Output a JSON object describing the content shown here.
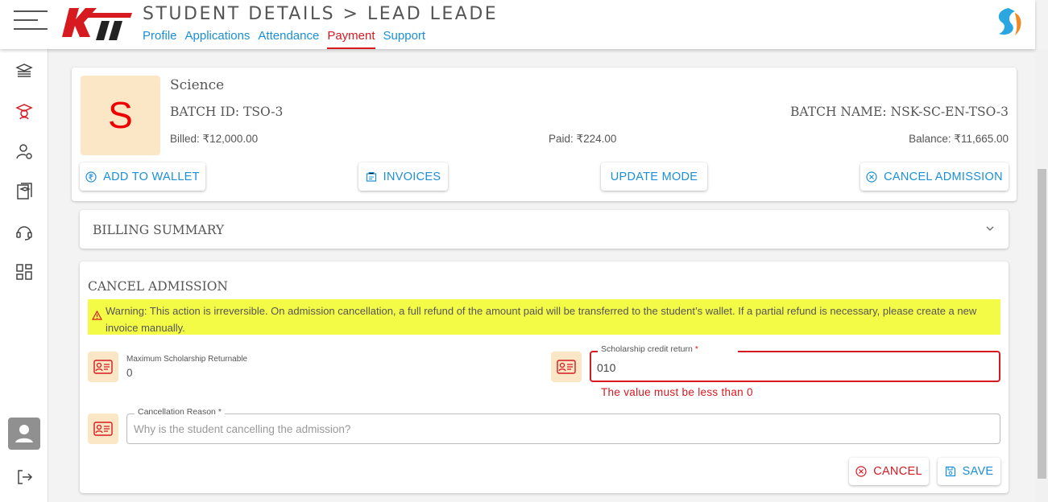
{
  "header": {
    "title": "STUDENT DETAILS > LEAD LEADE",
    "tabs": [
      "Profile",
      "Applications",
      "Attendance",
      "Payment",
      "Support"
    ],
    "active_tab": "Payment"
  },
  "batch": {
    "avatar_letter": "S",
    "subject": "Science",
    "batch_id": "BATCH ID: TSO-3",
    "batch_name": "BATCH NAME: NSK-SC-EN-TSO-3",
    "billed": "Billed: ₹12,000.00",
    "paid": "Paid: ₹224.00",
    "balance": "Balance: ₹11,665.00"
  },
  "actions": {
    "add_wallet": "ADD TO WALLET",
    "invoices": "INVOICES",
    "update_mode": "UPDATE MODE",
    "cancel_admission": "CANCEL ADMISSION"
  },
  "billing": {
    "title": "BILLING SUMMARY"
  },
  "cancel_form": {
    "title": "CANCEL ADMISSION",
    "warning": "Warning: This action is irreversible. On admission cancellation, a full refund of the amount paid will be transferred to the student’s wallet. If a partial refund is necessary, please create a new invoice manually.",
    "max_label": "Maximum Scholarship Returnable",
    "max_value": "0",
    "credit_label": "Scholarship credit return",
    "credit_value": "010",
    "credit_error": "The value must be less than 0",
    "reason_label": "Cancellation Reason",
    "reason_placeholder": "Why is the student cancelling the admission?",
    "required_mark": "*",
    "cancel_btn": "CANCEL",
    "save_btn": "SAVE"
  },
  "colors": {
    "accent": "#1a8fd8",
    "brand_red": "#d71920",
    "warning_bg": "#f4fb47",
    "icon_bg": "#fbe7c6"
  }
}
